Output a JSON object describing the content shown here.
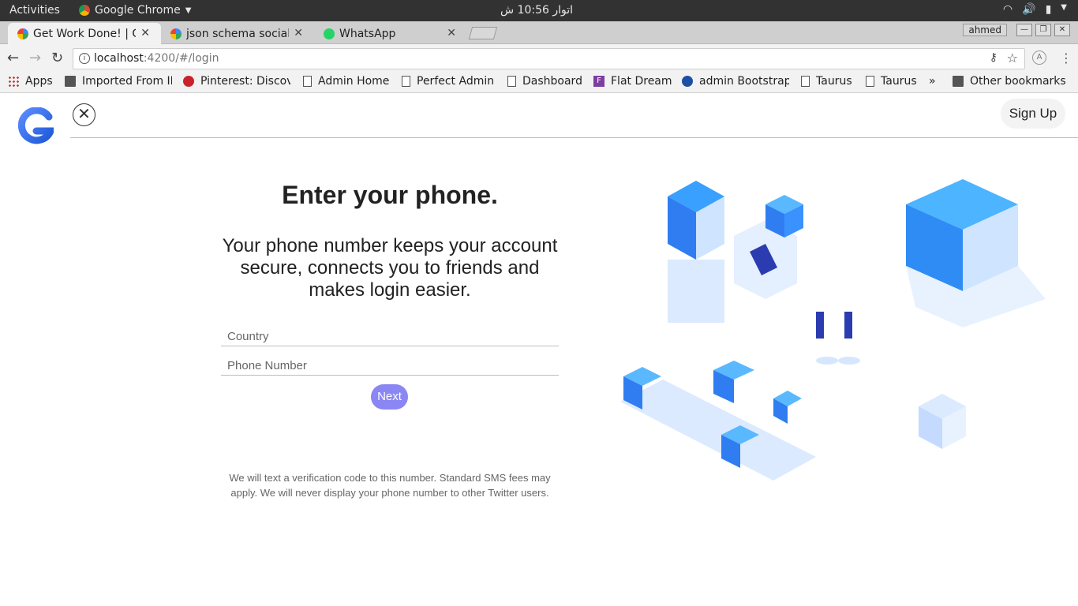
{
  "system": {
    "activities": "Activities",
    "app_name": "Google Chrome",
    "clock": "اتوار 10:56 ش"
  },
  "tabs": [
    {
      "title": "Get Work Done! | Ge",
      "active": true,
      "favicon": "google-g-icon"
    },
    {
      "title": "json schema social",
      "active": false,
      "favicon": "google-icon"
    },
    {
      "title": "WhatsApp",
      "active": false,
      "favicon": "whatsapp-icon"
    }
  ],
  "profile": {
    "name": "ahmed"
  },
  "address": {
    "host": "localhost",
    "path": ":4200/#/login"
  },
  "bookmarks": [
    {
      "label": "Apps",
      "icon": "grid"
    },
    {
      "label": "Imported From IE",
      "icon": "folder"
    },
    {
      "label": "Pinterest: Discover",
      "icon": "pin"
    },
    {
      "label": "Admin Home",
      "icon": "page"
    },
    {
      "label": "Perfect Admin",
      "icon": "page"
    },
    {
      "label": "Dashboard",
      "icon": "page"
    },
    {
      "label": "Flat Dream",
      "icon": "fd"
    },
    {
      "label": "admin Bootstrap",
      "icon": "ab"
    },
    {
      "label": "Taurus",
      "icon": "page"
    },
    {
      "label": "Taurus",
      "icon": "page"
    },
    {
      "label": "»",
      "icon": ""
    },
    {
      "label": "Other bookmarks",
      "icon": "folder"
    }
  ],
  "page": {
    "signup_label": "Sign Up",
    "title": "Enter your phone.",
    "subtitle": "Your phone number keeps your account secure, connects you to friends and makes login easier.",
    "country_placeholder": "Country",
    "phone_placeholder": "Phone Number",
    "next_label": "Next",
    "note": "We will text a verification code to this number. Standard SMS fees may apply. We will never display your phone number to other Twitter users.",
    "colors": {
      "accent": "#8a86f4",
      "illustration_blue": "#3ea6ff"
    }
  }
}
